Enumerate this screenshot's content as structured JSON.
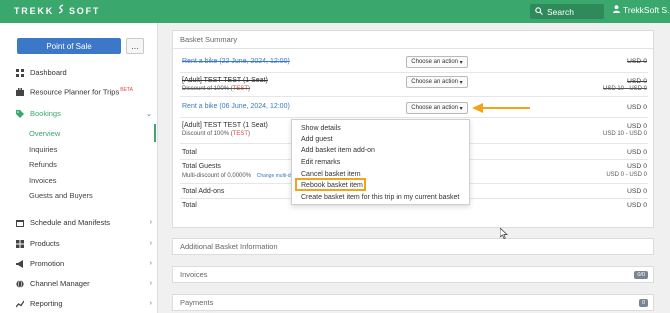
{
  "topbar": {
    "logo_left": "TREKK",
    "logo_right": "SOFT",
    "search_label": "Search",
    "user_label": "TrekkSoft S."
  },
  "sidebar": {
    "pos_button": "Point of Sale",
    "more_button": "...",
    "items": [
      {
        "label": "Dashboard",
        "icon": "chart-icon"
      },
      {
        "label": "Resource Planner for Trips",
        "badge": "BETA",
        "icon": "briefcase-icon"
      },
      {
        "label": "Bookings",
        "icon": "tag-icon"
      },
      {
        "label": "Schedule and Manifests",
        "icon": "calendar-icon"
      },
      {
        "label": "Products",
        "icon": "grid-icon"
      },
      {
        "label": "Promotion",
        "icon": "megaphone-icon"
      },
      {
        "label": "Channel Manager",
        "icon": "globe-icon"
      },
      {
        "label": "Reporting",
        "icon": "line-chart-icon"
      }
    ],
    "sub_items": [
      "Overview",
      "Inquiries",
      "Refunds",
      "Invoices",
      "Guests and Buyers"
    ]
  },
  "summary": {
    "title": "Basket Summary",
    "rows": [
      {
        "title": "Rent a bike (22 June, 2024, 12:00)",
        "action": "Choose an action",
        "price": "USD 0"
      },
      {
        "title": "[Adult] TEST TEST (1 Seat)",
        "discount": "Discount of 100% (",
        "test": "TEST",
        "close": ")",
        "action": "Choose an action",
        "price": "USD 0",
        "price_sub": "USD 10 - USD 0"
      },
      {
        "title": "Rent a bike (06 June, 2024, 12:00)",
        "action": "Choose an action",
        "price": "USD 0"
      },
      {
        "title": "[Adult] TEST TEST (1 Seat)",
        "discount": "Discount of 100% (",
        "test": "TEST",
        "close": ")",
        "price": "USD 0",
        "price_sub": "USD 10 - USD 0"
      }
    ],
    "total_label": "Total",
    "total_price": "USD 0",
    "guests_label": "Total Guests",
    "guests_sub": "Multi-discount of 0.0000%",
    "guests_link": "Change multi-disc",
    "guests_price": "USD 0",
    "guests_price_sub": "USD 0 - USD 0",
    "addons_label": "Total Add-ons",
    "addons_price": "USD 0",
    "total2_label": "Total",
    "total2_price": "USD 0"
  },
  "dropdown": {
    "items": [
      "Show details",
      "Add guest",
      "Add basket item add-on",
      "Edit remarks",
      "Cancel basket item",
      "Rebook basket item",
      "Create basket item for this trip in my current basket"
    ]
  },
  "panels": {
    "additional": "Additional Basket Information",
    "invoices": "Invoices",
    "invoices_badge": "0/0",
    "payments": "Payments",
    "payments_badge": "0"
  },
  "colors": {
    "brand_green": "#3aa76d",
    "accent_blue": "#3b78c8",
    "highlight_orange": "#f2a31c"
  }
}
